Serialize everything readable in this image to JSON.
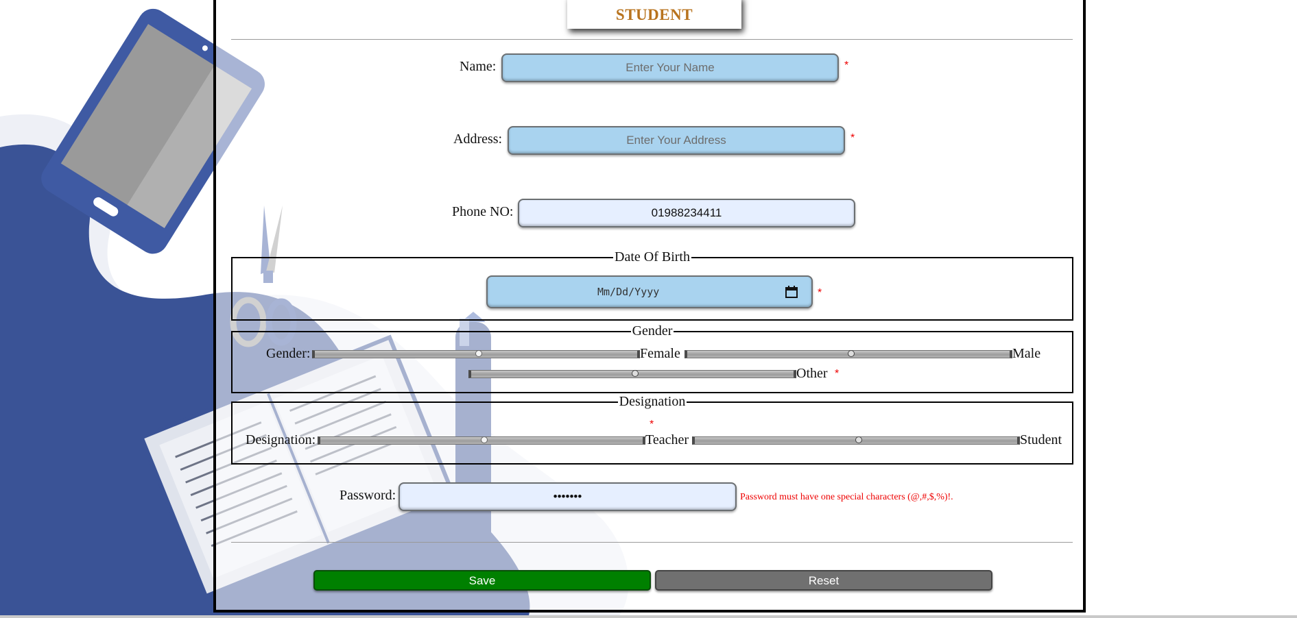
{
  "colors": {
    "title": "#b8731e",
    "input_blue": "#a9d3ef",
    "input_light": "#e6efff",
    "required": "#e00000",
    "save": "#008000",
    "reset": "#707070",
    "deco_blue": "#3a5396"
  },
  "form": {
    "title": "STUDENT",
    "name": {
      "label": "Name:",
      "placeholder": "Enter Your Name",
      "required_mark": "*"
    },
    "address": {
      "label": "Address:",
      "placeholder": "Enter Your Address",
      "required_mark": "*"
    },
    "phone": {
      "label": "Phone NO:",
      "value": "01988234411"
    },
    "dob": {
      "legend": "Date Of Birth",
      "placeholder": "Mm/Dd/Yyyy",
      "required_mark": "*"
    },
    "gender": {
      "legend": "Gender",
      "label": "Gender:",
      "options": [
        "Female",
        "Male",
        "Other"
      ],
      "selected": "Female",
      "required_mark": "*"
    },
    "designation": {
      "legend": "Designation",
      "label": "Designation:",
      "options": [
        "Teacher",
        "Student"
      ],
      "selected": "Teacher",
      "required_mark": "*"
    },
    "password": {
      "label": "Password:",
      "value": "•••••••",
      "hint": "Password must have one special characters (@,#,$,%)!."
    },
    "buttons": {
      "save": "Save",
      "reset": "Reset"
    }
  },
  "icons": [
    "tablet-icon",
    "scissors-icon",
    "pen-icon",
    "book-icon",
    "calendar-icon"
  ]
}
